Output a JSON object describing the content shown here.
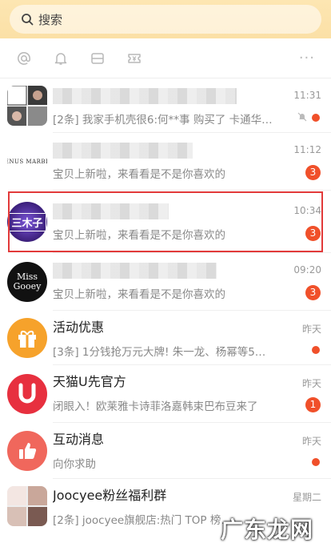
{
  "search": {
    "label": "搜索"
  },
  "quickbar": {
    "items": [
      "at-icon",
      "bell-icon",
      "inbox-icon",
      "coupon-icon"
    ],
    "more": "···"
  },
  "messages": [
    {
      "title": "",
      "subtitle": "[2条] 我家手机壳很6:何**事 购买了 卡通华…",
      "time": "11:31",
      "indicator": "dot",
      "muted": true,
      "avatar": "group"
    },
    {
      "title": "",
      "subtitle": "宝贝上新啦，来看看是不是你喜欢的",
      "time": "11:12",
      "indicator": "badge",
      "badge": "3",
      "avatar": "venus",
      "avatar_text": "VENUS MARBLE"
    },
    {
      "title": "",
      "subtitle": "宝贝上新啦，来看看是不是你喜欢的",
      "time": "10:34",
      "indicator": "badge",
      "badge": "3",
      "avatar": "sanmuzi",
      "avatar_text": "三木子"
    },
    {
      "title": "",
      "subtitle": "宝贝上新啦，来看看是不是你喜欢的",
      "time": "09:20",
      "indicator": "badge",
      "badge": "3",
      "avatar": "missgooey",
      "avatar_text": "Miss Gooey"
    },
    {
      "title": "活动优惠",
      "subtitle": "[3条] 1分钱抢万元大牌! 朱一龙、杨幂等5…",
      "time": "昨天",
      "indicator": "dot",
      "avatar": "gift"
    },
    {
      "title": "天猫U先官方",
      "subtitle": "闭眼入！欧莱雅卡诗菲洛嘉韩束巴布豆来了",
      "time": "昨天",
      "indicator": "badge",
      "badge": "1",
      "avatar": "u"
    },
    {
      "title": "互动消息",
      "subtitle": "向你求助",
      "time": "昨天",
      "indicator": "dot",
      "avatar": "thumb"
    },
    {
      "title": "Joocyee粉丝福利群",
      "subtitle": "[2条] joocyee旗舰店:热门 TOP 榜…",
      "time": "星期二",
      "indicator": "none",
      "avatar": "joocyee"
    }
  ],
  "colors": {
    "accent": "#f0502a",
    "header": "#fbe0a6",
    "gift": "#f6a22b",
    "u": "#e7303f",
    "thumb": "#f0675c",
    "highlight": "#e23a3a"
  },
  "watermark": "广东龙网"
}
